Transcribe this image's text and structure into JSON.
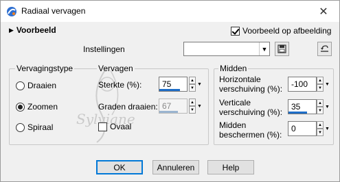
{
  "window": {
    "title": "Radiaal vervagen",
    "close_icon": "close-icon"
  },
  "preview": {
    "label": "Voorbeeld",
    "checkbox_label": "Voorbeeld op afbeelding",
    "checked": true
  },
  "settings": {
    "label": "Instellingen",
    "value": ""
  },
  "blur_type": {
    "title": "Vervagingstype",
    "options": [
      {
        "label": "Draaien",
        "selected": false
      },
      {
        "label": "Zoomen",
        "selected": true
      },
      {
        "label": "Spiraal",
        "selected": false
      }
    ]
  },
  "blur": {
    "title": "Vervagen",
    "strength_label": "Sterkte (%):",
    "strength_value": "75",
    "rotate_label": "Graden draaien:",
    "rotate_value": "67",
    "oval_label": "Ovaal",
    "oval_checked": false
  },
  "center": {
    "title": "Midden",
    "h_offset_label_1": "Horizontale",
    "h_offset_label_2": "verschuiving (%):",
    "h_offset_value": "-100",
    "v_offset_label_1": "Verticale",
    "v_offset_label_2": "verschuiving (%):",
    "v_offset_value": "35",
    "protect_label_1": "Midden",
    "protect_label_2": "beschermen (%):",
    "protect_value": "0"
  },
  "watermark": {
    "text": "Sylviane"
  },
  "buttons": {
    "ok": "OK",
    "cancel": "Annuleren",
    "help": "Help"
  }
}
